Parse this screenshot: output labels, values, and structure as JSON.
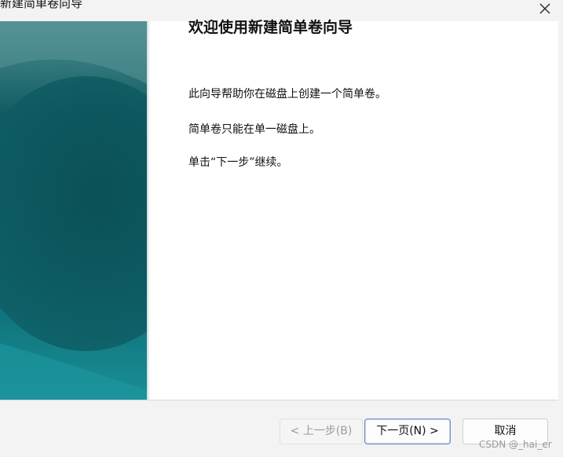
{
  "window": {
    "title": "新建简单卷向导",
    "close_glyph": "×"
  },
  "banner": {
    "colors": [
      "#0e4f55",
      "#0c6c73",
      "#1a8e97"
    ]
  },
  "page": {
    "heading": "欢迎使用新建简单卷向导",
    "paragraphs": [
      "此向导帮助你在磁盘上创建一个简单卷。",
      "简单卷只能在单一磁盘上。",
      "单击“下一步”继续。"
    ]
  },
  "buttons": {
    "back_label": "< 上一步(B)",
    "next_label": "下一页(N) >",
    "cancel_label": "取消"
  },
  "watermark": "CSDN @_hai_er"
}
